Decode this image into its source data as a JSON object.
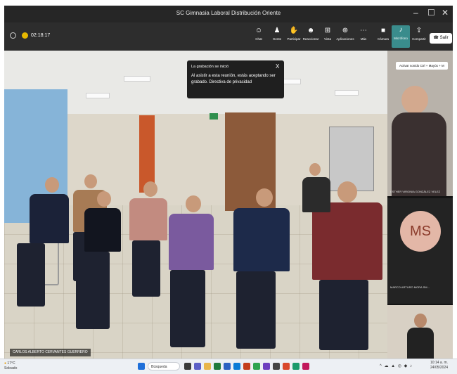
{
  "window": {
    "title": "SC Gimnasia Laboral Distribución Oriente",
    "minimize": "–",
    "maximize": "☐",
    "close": "✕"
  },
  "meeting": {
    "timer": "02:18:17"
  },
  "toolbar": {
    "buttons": [
      {
        "label": "Chat",
        "icon": "☺"
      },
      {
        "label": "Gente",
        "icon": "♟"
      },
      {
        "label": "Participar",
        "icon": "✋"
      },
      {
        "label": "Reaccionar",
        "icon": "☻"
      },
      {
        "label": "Vista",
        "icon": "⊞"
      },
      {
        "label": "Aplicaciones",
        "icon": "⊕"
      },
      {
        "label": "Más",
        "icon": "⋯"
      },
      {
        "label": "Cámara",
        "icon": "■"
      },
      {
        "label": "Micrófono",
        "icon": "♪"
      },
      {
        "label": "Compartir",
        "icon": "⇪"
      }
    ],
    "leave_label": "Salir",
    "leave_icon": "☎"
  },
  "notice": {
    "title": "La grabación se inició",
    "body": "Al asistir a esta reunión, estás aceptando ser grabado. Directiva de privacidad",
    "close": "X"
  },
  "main_video": {
    "name": "CARLOS ALBERTO CERVANTES GUERRERO"
  },
  "side_tiles": [
    {
      "name": "ESTHER VIRGINIA GONZÁLEZ VELEZ"
    },
    {
      "name": "MARCO ARTURO MORA SM...",
      "initials": "MS"
    },
    {
      "name": ""
    }
  ],
  "tooltip": {
    "text": "Activar sonido Ctrl + Mayús + M"
  },
  "taskbar": {
    "weather": "17°C",
    "weather_sub": "Soleado",
    "search": "Búsqueda",
    "time": "10:14 a. m.",
    "date": "24/05/2024"
  },
  "colors": {
    "accent": "#3a8c8c",
    "taskbar": "#edf0f4",
    "window_bg": "#202020"
  }
}
